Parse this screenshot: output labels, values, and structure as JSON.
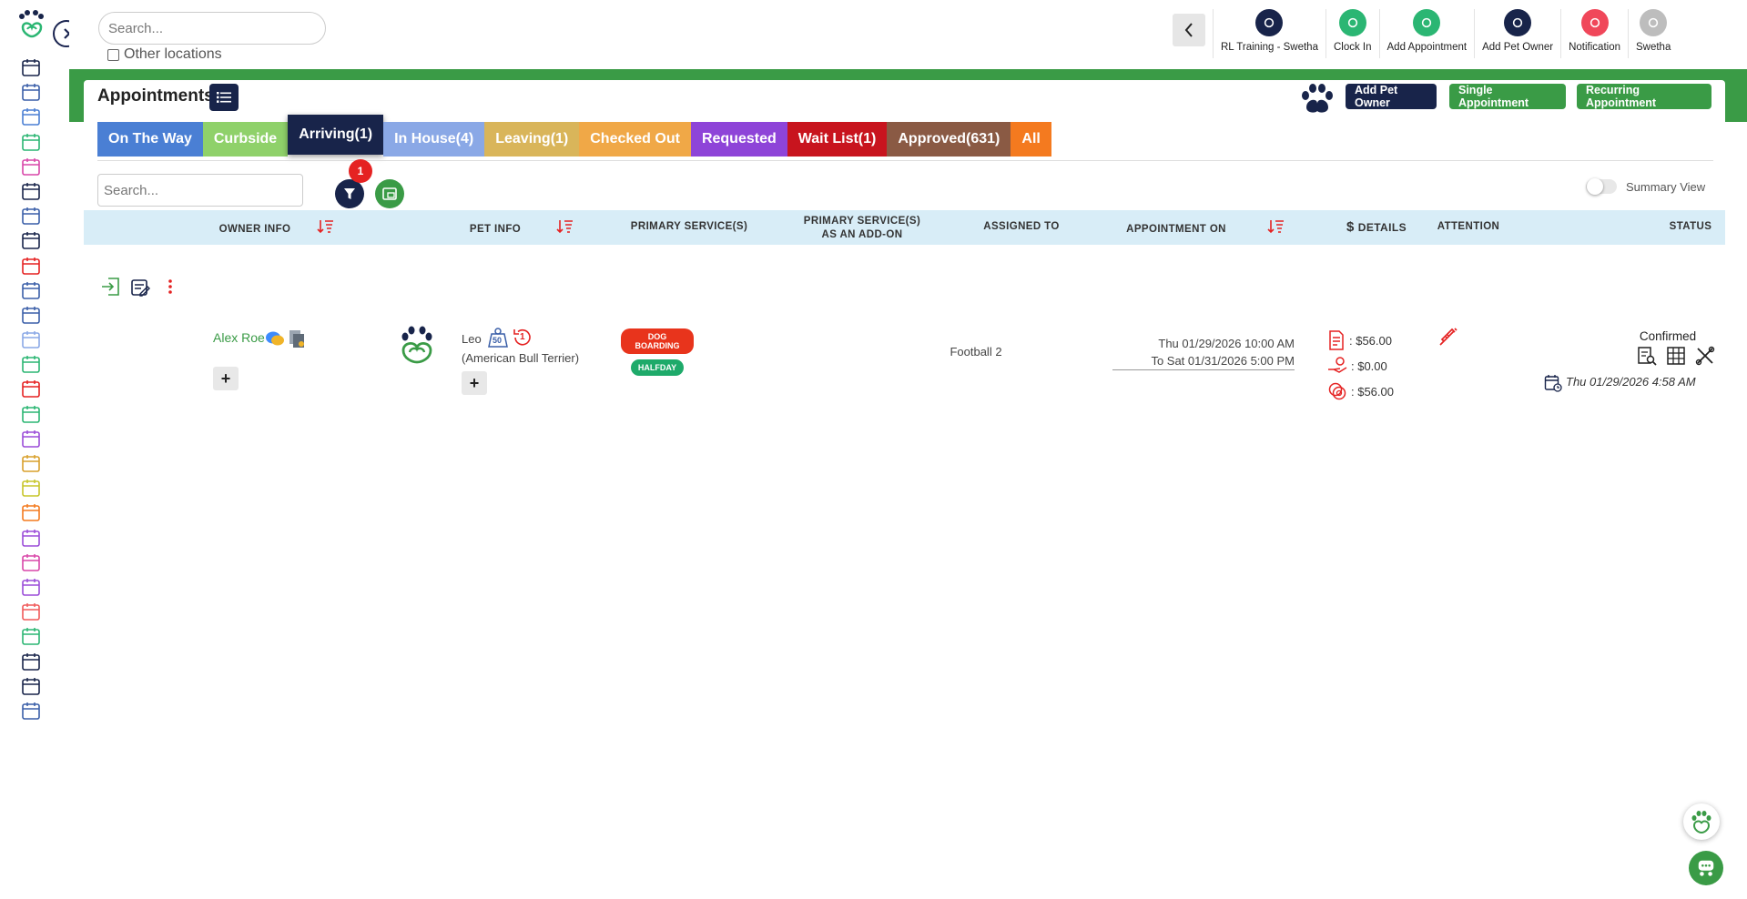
{
  "topbar": {
    "search_placeholder": "Search...",
    "other_locations_label": "Other locations",
    "actions": [
      {
        "label": "RL Training - Swetha",
        "icon": "location-pin-icon",
        "color": "#18244a"
      },
      {
        "label": "Clock In",
        "icon": "clock-icon",
        "color": "#2bb673"
      },
      {
        "label": "Add Appointment",
        "icon": "add-appointment-icon",
        "color": "#2bb673"
      },
      {
        "label": "Add Pet Owner",
        "icon": "add-user-icon",
        "color": "#18244a"
      },
      {
        "label": "Notification",
        "icon": "bell-icon",
        "color": "#f0475a"
      },
      {
        "label": "Swetha",
        "icon": "user-avatar-icon",
        "color": "#bdbdbd"
      }
    ]
  },
  "sidebar": {
    "items": [
      "today-icon",
      "dashboard-icon",
      "calendar-icon",
      "paw-icon",
      "kennel-icon",
      "checklist-icon",
      "pet-profile-icon",
      "today-edit-icon",
      "calendar-edit-icon",
      "calendar-grid-icon",
      "calendar-user-icon",
      "layout-icon",
      "report-icon",
      "invoice-icon",
      "cart-icon",
      "cart-clock-icon",
      "paws-icon",
      "shield-icon",
      "user-icon",
      "chat-icon",
      "gallery-icon",
      "thumbs-up-icon",
      "rocket-icon",
      "analytics-lock-icon",
      "clock-settings-icon",
      "team-icon",
      "tools-lock-icon"
    ]
  },
  "page": {
    "title": "Appointments",
    "buttons": {
      "add_pet_owner": "Add Pet Owner",
      "single_appointment": "Single Appointment",
      "recurring_appointment": "Recurring Appointment"
    },
    "tabs": [
      {
        "label": "On The Way",
        "color": "#4a7fd4",
        "active": false
      },
      {
        "label": "Curbside",
        "color": "#8fd16a",
        "active": false
      },
      {
        "label": "Arriving(1)",
        "color": "#18244a",
        "active": true
      },
      {
        "label": "In House(4)",
        "color": "#8aa8e6",
        "active": false
      },
      {
        "label": "Leaving(1)",
        "color": "#d9b55a",
        "active": false
      },
      {
        "label": "Checked Out",
        "color": "#f0a847",
        "active": false
      },
      {
        "label": "Requested",
        "color": "#8e44d8",
        "active": false
      },
      {
        "label": "Wait List(1)",
        "color": "#c8141e",
        "active": false
      },
      {
        "label": "Approved(631)",
        "color": "#8a5a44",
        "active": false
      },
      {
        "label": "All",
        "color": "#f47a1f",
        "active": false
      }
    ],
    "table_search_placeholder": "Search...",
    "filter_count": "1",
    "summary_view_label": "Summary View"
  },
  "table": {
    "headers": {
      "owner_info": "OWNER INFO",
      "pet_info": "PET INFO",
      "primary_services": "PRIMARY SERVICE(S)",
      "primary_services_addon_1": "PRIMARY SERVICE(S)",
      "primary_services_addon_2": "AS AN ADD-ON",
      "assigned_to": "ASSIGNED TO",
      "appointment_on": "APPOINTMENT ON",
      "details": "DETAILS",
      "details_symbol": "$",
      "attention": "ATTENTION",
      "status": "STATUS"
    },
    "rows": [
      {
        "owner_name": "Alex Roe",
        "pet_name": "Leo",
        "pet_weight": "50",
        "pet_breed": "(American Bull Terrier)",
        "pet_history_count": "1",
        "services": [
          {
            "label": "DOG BOARDING",
            "color": "#e8341c"
          },
          {
            "label": "HALFDAY",
            "color": "#1eaa6a"
          }
        ],
        "assigned_to": "Football 2",
        "appointment_from": "Thu 01/29/2026 10:00 AM",
        "appointment_to": "To Sat 01/31/2026 5:00 PM",
        "details": {
          "invoice": ": $56.00",
          "paid": ": $0.00",
          "due": ": $56.00"
        },
        "status": "Confirmed",
        "status_time": "Thu 01/29/2026 4:58 AM"
      }
    ]
  }
}
